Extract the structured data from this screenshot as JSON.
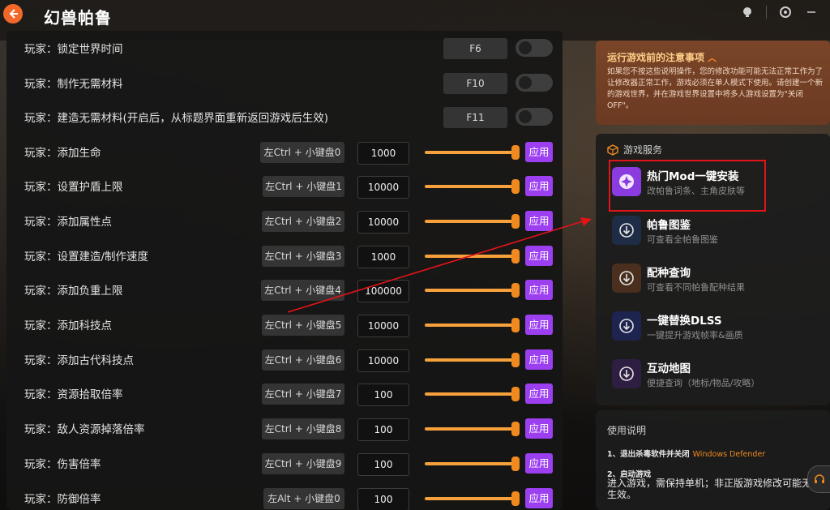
{
  "app": {
    "title": "幻兽帕鲁"
  },
  "colors": {
    "accent": "#9c3ff0",
    "slider": "#f08a1e",
    "notice_bg": "#7a4528",
    "highlight": "#e3131a"
  },
  "toggles": [
    {
      "label": "玩家：锁定世界时间",
      "hotkey": "F6"
    },
    {
      "label": "玩家：制作无需材料",
      "hotkey": "F10"
    },
    {
      "label": "玩家：建造无需材料(开启后，从标题界面重新返回游戏后生效)",
      "hotkey": "F11"
    }
  ],
  "sliders": [
    {
      "label": "玩家：添加生命",
      "hotkey": "左Ctrl + 小键盘0",
      "value": "1000"
    },
    {
      "label": "玩家：设置护盾上限",
      "hotkey": "左Ctrl + 小键盘1",
      "value": "10000"
    },
    {
      "label": "玩家：添加属性点",
      "hotkey": "左Ctrl + 小键盘2",
      "value": "10000"
    },
    {
      "label": "玩家：设置建造/制作速度",
      "hotkey": "左Ctrl + 小键盘3",
      "value": "1000"
    },
    {
      "label": "玩家：添加负重上限",
      "hotkey": "左Ctrl + 小键盘4",
      "value": "100000"
    },
    {
      "label": "玩家：添加科技点",
      "hotkey": "左Ctrl + 小键盘5",
      "value": "10000"
    },
    {
      "label": "玩家：添加古代科技点",
      "hotkey": "左Ctrl + 小键盘6",
      "value": "10000"
    },
    {
      "label": "玩家：资源拾取倍率",
      "hotkey": "左Ctrl + 小键盘7",
      "value": "100"
    },
    {
      "label": "玩家：敌人资源掉落倍率",
      "hotkey": "左Ctrl + 小键盘8",
      "value": "100"
    },
    {
      "label": "玩家：伤害倍率",
      "hotkey": "左Ctrl + 小键盘9",
      "value": "100"
    },
    {
      "label": "玩家：防御倍率",
      "hotkey": "左Alt + 小键盘0",
      "value": "100"
    }
  ],
  "apply_label": "应用",
  "notice": {
    "title": "运行游戏前的注意事项",
    "text": "如果您不按这些说明操作，您的修改功能可能无法正常工作为了让修改器正常工作，游戏必须在单人模式下使用。请创建一个新的游戏世界，并在游戏世界设置中将多人游戏设置为\"关闭OFF\"。"
  },
  "services": {
    "header": "游戏服务",
    "items": [
      {
        "title": "热门Mod一键安装",
        "sub": "改帕鲁词条、主角皮肤等",
        "icon": "mod-icon",
        "color": "#8a3ce0"
      },
      {
        "title": "帕鲁图鉴",
        "sub": "可查看全帕鲁图鉴",
        "icon": "download-icon",
        "color": "#1f2c46"
      },
      {
        "title": "配种查询",
        "sub": "可查看不同帕鲁配种结果",
        "icon": "download-icon",
        "color": "#4a2f1e"
      },
      {
        "title": "一键替换DLSS",
        "sub": "一键提升游戏帧率&画质",
        "icon": "download-icon",
        "color": "#1e2450"
      },
      {
        "title": "互动地图",
        "sub": "便捷查询（地标/物品/攻略）",
        "icon": "download-icon",
        "color": "#2e1e42"
      }
    ]
  },
  "usage": {
    "title": "使用说明",
    "step1": "1、退出杀毒软件并关闭",
    "step1_link": "Windows Defender",
    "step2": "2、启动游戏",
    "step2_text": "进入游戏，需保持单机；非正版游戏修改可能无法生效。"
  }
}
